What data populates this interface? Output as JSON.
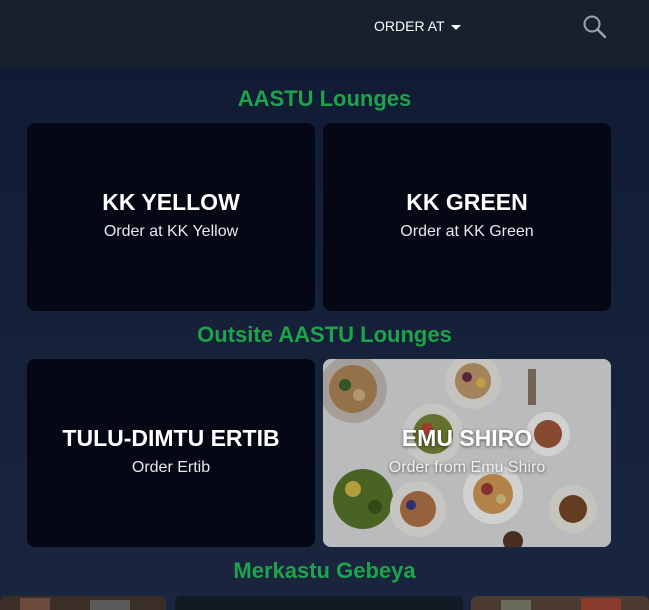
{
  "header": {
    "order_at_label": "ORDER AT",
    "icons": {
      "dropdown": "caret-down-icon",
      "search": "search-icon"
    }
  },
  "sections": [
    {
      "title": "AASTU Lounges",
      "cards": [
        {
          "name": "KK YELLOW",
          "subtitle": "Order at KK Yellow"
        },
        {
          "name": "KK GREEN",
          "subtitle": "Order at KK Green"
        }
      ]
    },
    {
      "title": "Outsite AASTU Lounges",
      "cards": [
        {
          "name": "TULU-DIMTU ERTIB",
          "subtitle": "Order Ertib"
        },
        {
          "name": "EMU SHIRO",
          "subtitle": "Order from Emu Shiro"
        }
      ]
    },
    {
      "title": "Merkastu Gebeya"
    }
  ],
  "colors": {
    "section_title": "#1fa34a",
    "card_bg": "#050814",
    "header_bg": "#17212d",
    "page_bg": "#131d36"
  }
}
